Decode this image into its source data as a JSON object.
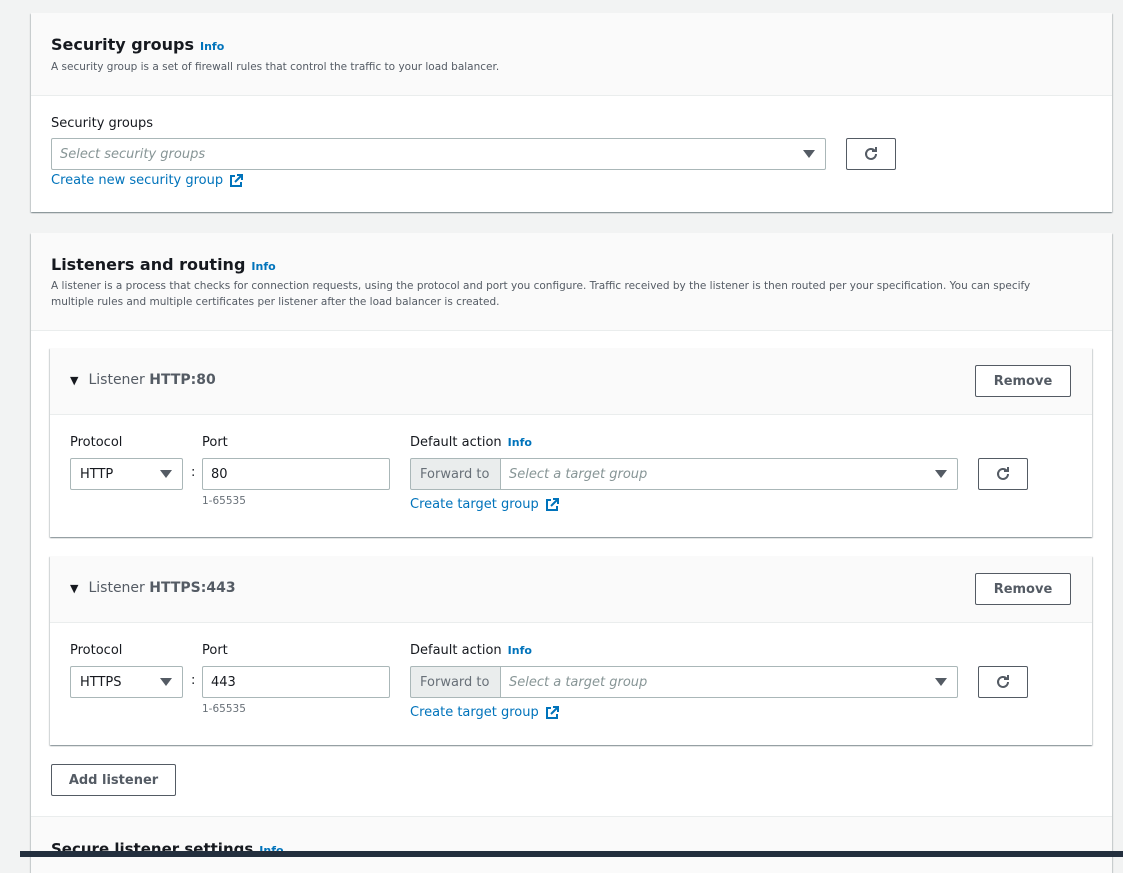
{
  "security_groups": {
    "title": "Security groups",
    "info": "Info",
    "description": "A security group is a set of firewall rules that control the traffic to your load balancer.",
    "field_label": "Security groups",
    "placeholder": "Select security groups",
    "create_link": "Create new security group"
  },
  "listeners": {
    "title": "Listeners and routing",
    "info": "Info",
    "description_line1": "A listener is a process that checks for connection requests, using the protocol and port you configure. Traffic received by the listener is then routed per your specification. You can specify",
    "description_line2": "multiple rules and multiple certificates per listener after the load balancer is created.",
    "items": [
      {
        "prefix": "Listener",
        "name": "HTTP:80",
        "remove": "Remove",
        "protocol_label": "Protocol",
        "protocol": "HTTP",
        "port_label": "Port",
        "port": "80",
        "port_hint": "1-65535",
        "action_label": "Default action",
        "action_info": "Info",
        "forward": "Forward to",
        "target_placeholder": "Select a target group",
        "create_link": "Create target group"
      },
      {
        "prefix": "Listener",
        "name": "HTTPS:443",
        "remove": "Remove",
        "protocol_label": "Protocol",
        "protocol": "HTTPS",
        "port_label": "Port",
        "port": "443",
        "port_hint": "1-65535",
        "action_label": "Default action",
        "action_info": "Info",
        "forward": "Forward to",
        "target_placeholder": "Select a target group",
        "create_link": "Create target group"
      }
    ],
    "add_listener": "Add listener",
    "separator": ":"
  },
  "secure_settings": {
    "title": "Secure listener settings",
    "info": "Info"
  }
}
